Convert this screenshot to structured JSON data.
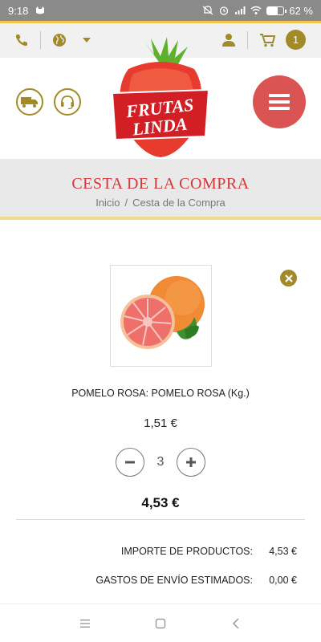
{
  "status_bar": {
    "time": "9:18",
    "battery": "62 %",
    "battery_level": 0.62
  },
  "top_bar": {
    "cart_count": "1"
  },
  "logo": {
    "line1": "FRUTAS",
    "line2": "LINDA"
  },
  "page": {
    "title": "CESTA DE LA COMPRA",
    "breadcrumb": [
      {
        "label": "Inicio"
      },
      {
        "label": "Cesta de la Compra"
      }
    ],
    "breadcrumb_sep": "/"
  },
  "cart_item": {
    "name": "POMELO ROSA: POMELO ROSA (Kg.)",
    "unit_price": "1,51 €",
    "quantity": "3",
    "line_total": "4,53 €"
  },
  "summary": {
    "products_label": "IMPORTE DE PRODUCTOS:",
    "products_value": "4,53 €",
    "shipping_label": "GASTOS DE ENVÍO ESTIMADOS:",
    "shipping_value": "0,00 €"
  },
  "colors": {
    "accent": "#a28a2a",
    "title_red": "#d4373a",
    "menu_red": "#d95453",
    "top_stripe": "#f0c34a"
  },
  "icons": [
    "phone-icon",
    "globe-icon",
    "caret-down-icon",
    "user-icon",
    "cart-icon",
    "truck-icon",
    "headset-icon",
    "hamburger-icon",
    "close-icon",
    "minus-icon",
    "plus-icon",
    "nav-menu-icon",
    "nav-home-icon",
    "nav-back-icon"
  ]
}
